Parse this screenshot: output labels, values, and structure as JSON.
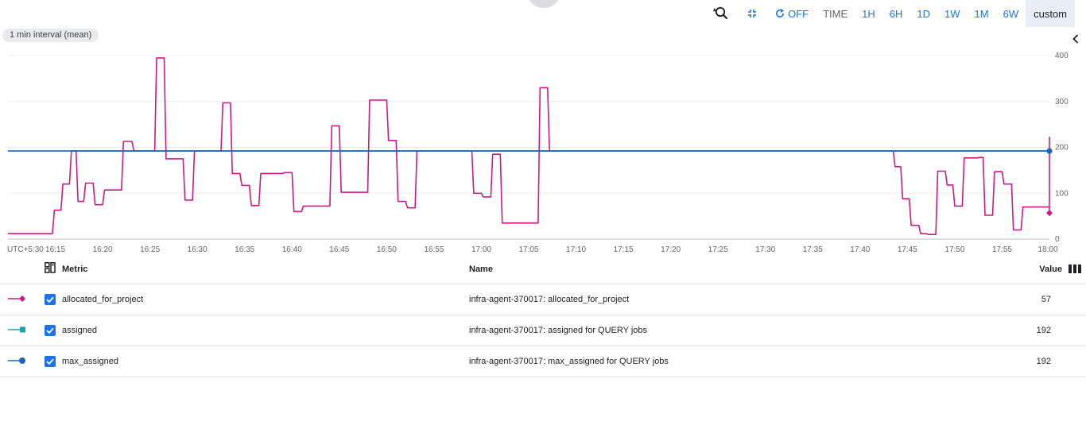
{
  "toolbar": {
    "refresh_label": "OFF",
    "time_label": "TIME",
    "ranges": [
      "1H",
      "6H",
      "1D",
      "1W",
      "1M",
      "6W"
    ],
    "custom_label": "custom"
  },
  "interval_chip": "1 min interval (mean)",
  "colors": {
    "allocated_for_project": "#d01884",
    "assigned": "#12a4af",
    "max_assigned": "#1a62c6"
  },
  "chart_data": {
    "type": "line",
    "x_tick_labels": [
      "UTC+5:30",
      "16:15",
      "16:20",
      "16:25",
      "16:30",
      "16:35",
      "16:40",
      "16:45",
      "16:50",
      "16:55",
      "17:00",
      "17:05",
      "17:10",
      "17:15",
      "17:20",
      "17:25",
      "17:30",
      "17:35",
      "17:40",
      "17:45",
      "17:50",
      "17:55",
      "18:00"
    ],
    "y_ticks": [
      0,
      100,
      200,
      300,
      400
    ],
    "ylim": [
      0,
      400
    ],
    "xlim": [
      "16:10",
      "18:00"
    ],
    "grid": true,
    "series": [
      {
        "name": "allocated_for_project",
        "color": "#d01884",
        "marker": "diamond",
        "points": [
          [
            "16:10",
            12
          ],
          [
            "16:14.7",
            12
          ],
          [
            "16:14.9",
            63
          ],
          [
            "16:15.6",
            63
          ],
          [
            "16:15.8",
            120
          ],
          [
            "16:16.5",
            120
          ],
          [
            "16:16.7",
            192
          ],
          [
            "16:17.2",
            192
          ],
          [
            "16:17.4",
            82
          ],
          [
            "16:18.0",
            82
          ],
          [
            "16:18.2",
            122
          ],
          [
            "16:19.0",
            122
          ],
          [
            "16:19.2",
            75
          ],
          [
            "16:20.0",
            75
          ],
          [
            "16:20.2",
            107
          ],
          [
            "16:22.0",
            107
          ],
          [
            "16:22.2",
            213
          ],
          [
            "16:23.1",
            213
          ],
          [
            "16:23.3",
            192
          ],
          [
            "16:25.5",
            192
          ],
          [
            "16:25.7",
            395
          ],
          [
            "16:26.5",
            395
          ],
          [
            "16:26.7",
            175
          ],
          [
            "16:28.5",
            175
          ],
          [
            "16:28.7",
            85
          ],
          [
            "16:29.5",
            85
          ],
          [
            "16:29.7",
            192
          ],
          [
            "16:32.5",
            192
          ],
          [
            "16:32.7",
            297
          ],
          [
            "16:33.5",
            297
          ],
          [
            "16:33.7",
            143
          ],
          [
            "16:34.5",
            143
          ],
          [
            "16:34.7",
            117
          ],
          [
            "16:35.5",
            117
          ],
          [
            "16:35.7",
            73
          ],
          [
            "16:36.5",
            73
          ],
          [
            "16:36.7",
            143
          ],
          [
            "16:39.0",
            143
          ],
          [
            "16:39.2",
            145
          ],
          [
            "16:40.0",
            145
          ],
          [
            "16:40.2",
            60
          ],
          [
            "16:41.0",
            60
          ],
          [
            "16:41.2",
            72
          ],
          [
            "16:44.0",
            72
          ],
          [
            "16:44.2",
            247
          ],
          [
            "16:45.0",
            247
          ],
          [
            "16:45.2",
            102
          ],
          [
            "16:48.0",
            102
          ],
          [
            "16:48.2",
            303
          ],
          [
            "16:50.0",
            303
          ],
          [
            "16:50.2",
            215
          ],
          [
            "16:51.0",
            215
          ],
          [
            "16:51.2",
            82
          ],
          [
            "16:52.0",
            82
          ],
          [
            "16:52.2",
            68
          ],
          [
            "16:53.0",
            68
          ],
          [
            "16:53.2",
            192
          ],
          [
            "16:59.0",
            192
          ],
          [
            "16:59.2",
            100
          ],
          [
            "17:00.0",
            100
          ],
          [
            "17:00.2",
            92
          ],
          [
            "17:01.0",
            92
          ],
          [
            "17:01.2",
            185
          ],
          [
            "17:02.0",
            185
          ],
          [
            "17:02.2",
            35
          ],
          [
            "17:06.0",
            35
          ],
          [
            "17:06.2",
            330
          ],
          [
            "17:07.0",
            330
          ],
          [
            "17:07.2",
            192
          ],
          [
            "17:43.5",
            192
          ],
          [
            "17:43.7",
            158
          ],
          [
            "17:44.3",
            158
          ],
          [
            "17:44.5",
            88
          ],
          [
            "17:45.2",
            88
          ],
          [
            "17:45.4",
            30
          ],
          [
            "17:46.2",
            30
          ],
          [
            "17:46.4",
            12
          ],
          [
            "17:47.0",
            12
          ],
          [
            "17:47.2",
            10
          ],
          [
            "17:48.0",
            10
          ],
          [
            "17:48.2",
            148
          ],
          [
            "17:49.0",
            148
          ],
          [
            "17:49.2",
            118
          ],
          [
            "17:49.8",
            118
          ],
          [
            "17:50.0",
            72
          ],
          [
            "17:50.8",
            72
          ],
          [
            "17:51.0",
            177
          ],
          [
            "17:52.4",
            177
          ],
          [
            "17:52.6",
            178
          ],
          [
            "17:53.0",
            178
          ],
          [
            "17:53.2",
            52
          ],
          [
            "17:54.0",
            52
          ],
          [
            "17:54.2",
            147
          ],
          [
            "17:55.0",
            147
          ],
          [
            "17:55.2",
            120
          ],
          [
            "17:56.0",
            120
          ],
          [
            "17:56.2",
            20
          ],
          [
            "17:57.0",
            20
          ],
          [
            "17:57.2",
            70
          ],
          [
            "18:00.0",
            70
          ],
          [
            "18:00.2",
            222
          ],
          [
            "18:01.2",
            222
          ],
          [
            "18:01.4",
            57
          ],
          [
            "18:06.0",
            57
          ]
        ]
      },
      {
        "name": "assigned",
        "color": "#12a4af",
        "marker": "square",
        "points": [
          [
            "16:16.7",
            192
          ],
          [
            "18:06.0",
            192
          ]
        ]
      },
      {
        "name": "max_assigned",
        "color": "#1a62c6",
        "marker": "circle",
        "points": [
          [
            "16:10",
            192
          ],
          [
            "18:06.0",
            192
          ]
        ]
      }
    ]
  },
  "table": {
    "headers": {
      "metric": "Metric",
      "name": "Name",
      "value": "Value"
    },
    "rows": [
      {
        "metric": "allocated_for_project",
        "name": "infra-agent-370017: allocated_for_project",
        "value": "57",
        "color": "#d01884",
        "marker": "diamond"
      },
      {
        "metric": "assigned",
        "name": "infra-agent-370017: assigned for QUERY jobs",
        "value": "192",
        "color": "#12a4af",
        "marker": "square"
      },
      {
        "metric": "max_assigned",
        "name": "infra-agent-370017: max_assigned for QUERY jobs",
        "value": "192",
        "color": "#1a62c6",
        "marker": "circle"
      }
    ]
  }
}
